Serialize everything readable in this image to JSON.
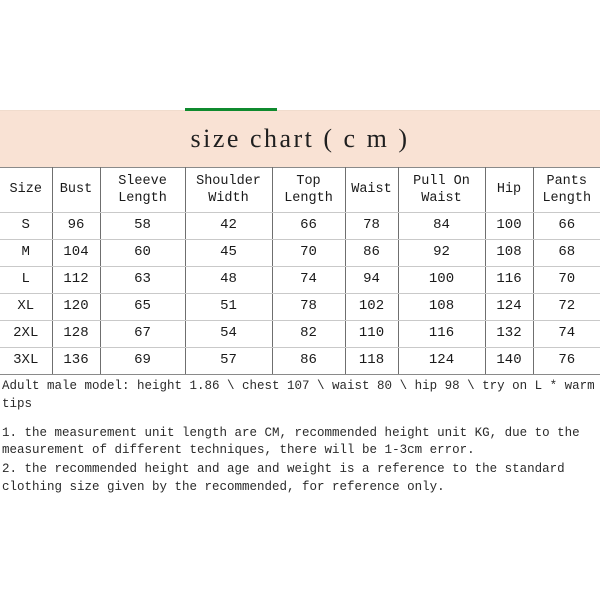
{
  "accent": {
    "banner_bg": "#f9e2d4",
    "green_rule": "#0f8a2e",
    "table_border": "#6f6f6f",
    "row_divider": "#c9c9c9"
  },
  "title": "size chart ( c m )",
  "table": {
    "headers": [
      "Size",
      "Bust",
      "Sleeve Length",
      "Shoulder Width",
      "Top Length",
      "Waist",
      "Pull On Waist",
      "Hip",
      "Pants Length"
    ],
    "rows": [
      [
        "S",
        "96",
        "58",
        "42",
        "66",
        "78",
        "84",
        "100",
        "66"
      ],
      [
        "M",
        "104",
        "60",
        "45",
        "70",
        "86",
        "92",
        "108",
        "68"
      ],
      [
        "L",
        "112",
        "63",
        "48",
        "74",
        "94",
        "100",
        "116",
        "70"
      ],
      [
        "XL",
        "120",
        "65",
        "51",
        "78",
        "102",
        "108",
        "124",
        "72"
      ],
      [
        "2XL",
        "128",
        "67",
        "54",
        "82",
        "110",
        "116",
        "132",
        "74"
      ],
      [
        "3XL",
        "136",
        "69",
        "57",
        "86",
        "118",
        "124",
        "140",
        "76"
      ]
    ]
  },
  "notes": {
    "model": "Adult male model: height 1.86 \\ chest 107 \\ waist 80 \\ hip 98 \\ try on L * warm tips",
    "items": [
      "1. the measurement unit length are CM, recommended height unit KG, due to the measurement of different techniques, there will be 1-3cm error.",
      "2. the recommended height and age and weight is a reference to the standard clothing size given by the recommended, for reference only."
    ]
  }
}
